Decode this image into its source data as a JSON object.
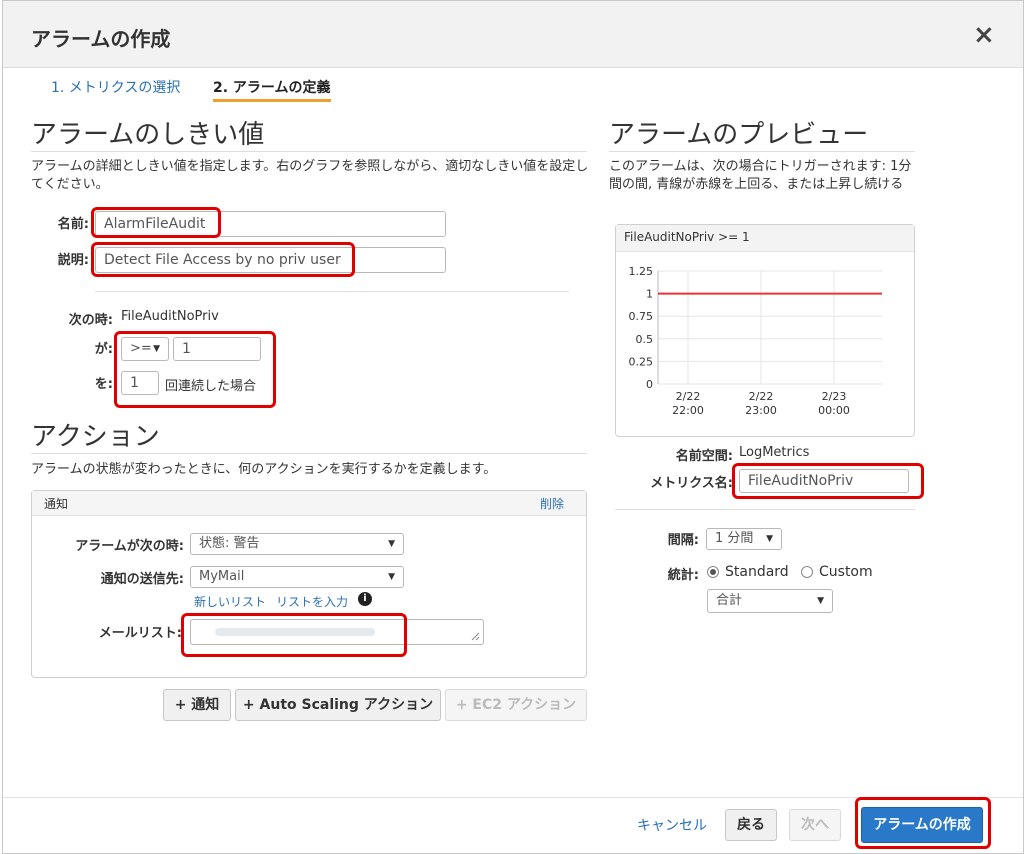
{
  "dialog": {
    "title": "アラームの作成",
    "close_label": "×"
  },
  "steps": [
    {
      "label": "1. メトリクスの選択",
      "active": false
    },
    {
      "label": "2. アラームの定義",
      "active": true
    }
  ],
  "threshold": {
    "heading": "アラームのしきい値",
    "description": "アラームの詳細としきい値を指定します。右のグラフを参照しながら、適切なしきい値を設定してください。",
    "name_label": "名前:",
    "name_value": "AlarmFileAudit",
    "desc_label": "説明:",
    "desc_value": "Detect File Access by no priv user",
    "when_label": "次の時:",
    "when_value": "FileAuditNoPriv",
    "is_label": "が:",
    "operator": ">=",
    "threshold_value": "1",
    "for_label": "を:",
    "periods_value": "1",
    "periods_suffix": "回連続した場合"
  },
  "actions": {
    "heading": "アクション",
    "description": "アラームの状態が変わったときに、何のアクションを実行するかを定義します。",
    "panel_title": "通知",
    "delete_label": "削除",
    "state_label": "アラームが次の時:",
    "state_value": "状態: 警告",
    "target_label": "通知の送信先:",
    "target_value": "MyMail",
    "new_list_link": "新しいリスト",
    "enter_list_link": "リストを入力",
    "email_label": "メールリスト:",
    "email_value": "",
    "btn_notify": "+ 通知",
    "btn_autoscaling": "+ Auto Scaling アクション",
    "btn_ec2": "+ EC2 アクション"
  },
  "preview": {
    "heading": "アラームのプレビュー",
    "description": "このアラームは、次の場合にトリガーされます: 1分間の間, 青線が赤線を上回る、または上昇し続ける",
    "namespace_label": "名前空間:",
    "namespace_value": "LogMetrics",
    "metric_label": "メトリクス名:",
    "metric_value": "FileAuditNoPriv",
    "period_label": "間隔:",
    "period_value": "1 分間",
    "stat_label": "統計:",
    "stat_standard": "Standard",
    "stat_custom": "Custom",
    "stat_value": "合計"
  },
  "chart_data": {
    "type": "line",
    "title": "FileAuditNoPriv >= 1",
    "y_ticks": [
      "1.25",
      "1",
      "0.75",
      "0.5",
      "0.25",
      "0"
    ],
    "ylim": [
      0,
      1.25
    ],
    "x_ticks": [
      {
        "date": "2/22",
        "time": "22:00"
      },
      {
        "date": "2/22",
        "time": "23:00"
      },
      {
        "date": "2/23",
        "time": "00:00"
      }
    ],
    "series": [
      {
        "values": [
          1,
          1,
          1
        ],
        "color": "#e8343a"
      }
    ],
    "grid": true
  },
  "footer": {
    "cancel": "キャンセル",
    "back": "戻る",
    "next": "次へ",
    "create": "アラームの作成"
  },
  "colors": {
    "accent": "#2a78c8",
    "highlight": "#e00000",
    "step_underline": "#f0a030"
  }
}
